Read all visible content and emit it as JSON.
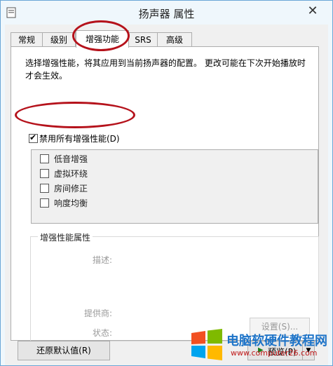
{
  "window": {
    "title": "扬声器 属性",
    "close_glyph": "✕"
  },
  "tabs": [
    {
      "label": "常规"
    },
    {
      "label": "级别"
    },
    {
      "label": "增强功能"
    },
    {
      "label": "SRS"
    },
    {
      "label": "高级"
    }
  ],
  "active_tab": "增强功能",
  "description": "选择增强性能，将其应用到当前扬声器的配置。 更改可能在下次开始播放时才会生效。",
  "master_toggle": {
    "label": "禁用所有增强性能(D)",
    "checked": true
  },
  "enhancements": [
    {
      "label": "低音增强",
      "checked": false
    },
    {
      "label": "虚拟环绕",
      "checked": false
    },
    {
      "label": "房间修正",
      "checked": false
    },
    {
      "label": "响度均衡",
      "checked": false
    }
  ],
  "properties": {
    "title": "增强性能属性",
    "description_label": "描述:",
    "provider_label": "提供商:",
    "status_label": "状态:",
    "settings_button": "设置(S)..."
  },
  "buttons": {
    "restore_defaults": "还原默认值(R)",
    "preview": "预览(P)"
  },
  "watermark": {
    "main": "电脑软硬件教程网",
    "sub": "www.computer26.com"
  },
  "colors": {
    "annotation": "#b5121b",
    "watermark_blue": "#1e74c8",
    "watermark_red": "#c01a1a"
  }
}
